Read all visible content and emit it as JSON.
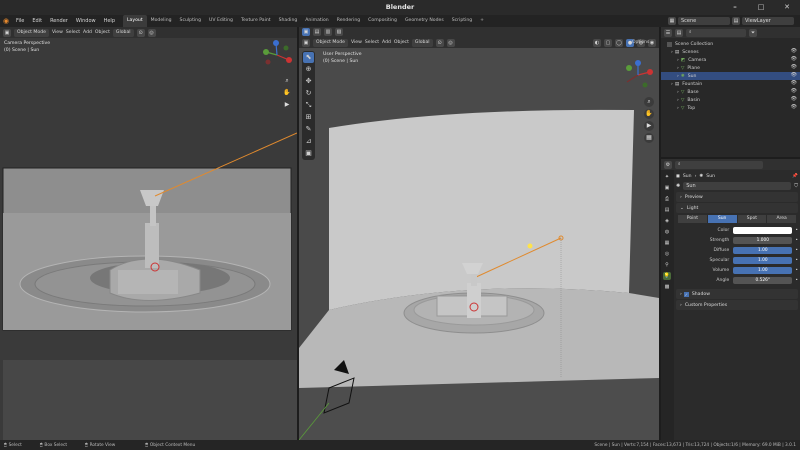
{
  "app": {
    "title": "Blender"
  },
  "menu": {
    "items": [
      "File",
      "Edit",
      "Render",
      "Window",
      "Help"
    ]
  },
  "workspaces": {
    "tabs": [
      "Layout",
      "Modeling",
      "Sculpting",
      "UV Editing",
      "Texture Paint",
      "Shading",
      "Animation",
      "Rendering",
      "Compositing",
      "Geometry Nodes",
      "Scripting"
    ],
    "active": "Layout",
    "add": "+"
  },
  "scene": {
    "name": "Scene",
    "view_layer": "ViewLayer"
  },
  "left_vp": {
    "mode": "Object Mode",
    "menus": [
      "View",
      "Select",
      "Add",
      "Object"
    ],
    "orientation": "Global",
    "title": "Camera Perspective",
    "subtitle": "(0) Scene | Sun"
  },
  "right_vp": {
    "mode": "Object Mode",
    "menus": [
      "View",
      "Select",
      "Add",
      "Object"
    ],
    "orientation": "Global",
    "options": "Options",
    "title": "User Perspective",
    "subtitle": "(0) Scene | Sun"
  },
  "outliner": {
    "root": "Scene Collection",
    "rows": [
      {
        "name": "Scenes",
        "indent": 1,
        "type": "collection"
      },
      {
        "name": "Camera",
        "indent": 2,
        "type": "camera"
      },
      {
        "name": "Plane",
        "indent": 2,
        "type": "mesh"
      },
      {
        "name": "Sun",
        "indent": 2,
        "type": "light",
        "selected": true
      },
      {
        "name": "Fountain",
        "indent": 1,
        "type": "collection"
      },
      {
        "name": "Base",
        "indent": 2,
        "type": "mesh"
      },
      {
        "name": "Basin",
        "indent": 2,
        "type": "mesh"
      },
      {
        "name": "Top",
        "indent": 2,
        "type": "mesh"
      }
    ]
  },
  "properties": {
    "breadcrumb_obj": "Sun",
    "breadcrumb_data": "Sun",
    "datablock": "Sun",
    "sections": {
      "preview": "Preview",
      "light": "Light",
      "shadow": "Shadow",
      "custom": "Custom Properties"
    },
    "light_types": [
      "Point",
      "Sun",
      "Spot",
      "Area"
    ],
    "active_type": "Sun",
    "fields": [
      {
        "label": "Color",
        "value": "",
        "kind": "color"
      },
      {
        "label": "Strength",
        "value": "1.000",
        "kind": "num"
      },
      {
        "label": "Diffuse",
        "value": "1.00",
        "kind": "slider"
      },
      {
        "label": "Specular",
        "value": "1.00",
        "kind": "slider"
      },
      {
        "label": "Volume",
        "value": "1.00",
        "kind": "slider"
      },
      {
        "label": "Angle",
        "value": "0.526°",
        "kind": "num"
      }
    ]
  },
  "status": {
    "select": "Select",
    "box_select": "Box Select",
    "rotate": "Rotate View",
    "context": "Object Context Menu",
    "stats": "Scene | Sun | Verts:7,154 | Faces:13,673 | Tris:13,724 | Objects:1/6 | Memory: 69.0 MiB | 3.0.1"
  },
  "colors": {
    "accent": "#4772b3",
    "orange": "#e08a2e",
    "selected_row": "#334d80"
  }
}
